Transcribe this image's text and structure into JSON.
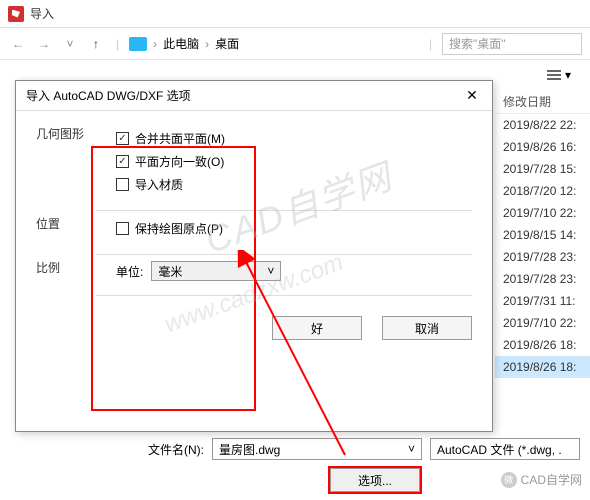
{
  "window": {
    "title": "导入"
  },
  "nav": {
    "location1": "此电脑",
    "location2": "桌面",
    "search_placeholder": "搜索\"桌面\""
  },
  "list": {
    "header_date": "修改日期",
    "dates": [
      "2019/8/22 22:",
      "2019/8/26 16:",
      "2019/7/28 15:",
      "2018/7/20 12:",
      "2019/7/10 22:",
      "2019/8/15 14:",
      "2019/7/28 23:",
      "2019/7/28 23:",
      "2019/7/31 11:",
      "2019/7/10 22:",
      "2019/8/26 18:",
      "2019/8/26 18:"
    ]
  },
  "dialog": {
    "title": "导入 AutoCAD DWG/DXF 选项",
    "sections": {
      "geometry": "几何图形",
      "position": "位置",
      "scale": "比例"
    },
    "checkboxes": {
      "merge": "合并共面平面(M)",
      "orient": "平面方向一致(O)",
      "import_mat": "导入材质",
      "keep_origin": "保持绘图原点(P)"
    },
    "checked": {
      "merge": true,
      "orient": true,
      "import_mat": false,
      "keep_origin": false
    },
    "unit_label": "单位:",
    "unit_value": "毫米",
    "ok": "好",
    "cancel": "取消"
  },
  "bottom": {
    "filename_label": "文件名(N):",
    "filename_value": "量房图.dwg",
    "filetype": "AutoCAD 文件 (*.dwg, .",
    "options_btn": "选项..."
  },
  "watermark": {
    "main": "CAD自学网",
    "url": "www.cadzxw.com"
  },
  "badge": {
    "text": "CAD自学网"
  }
}
